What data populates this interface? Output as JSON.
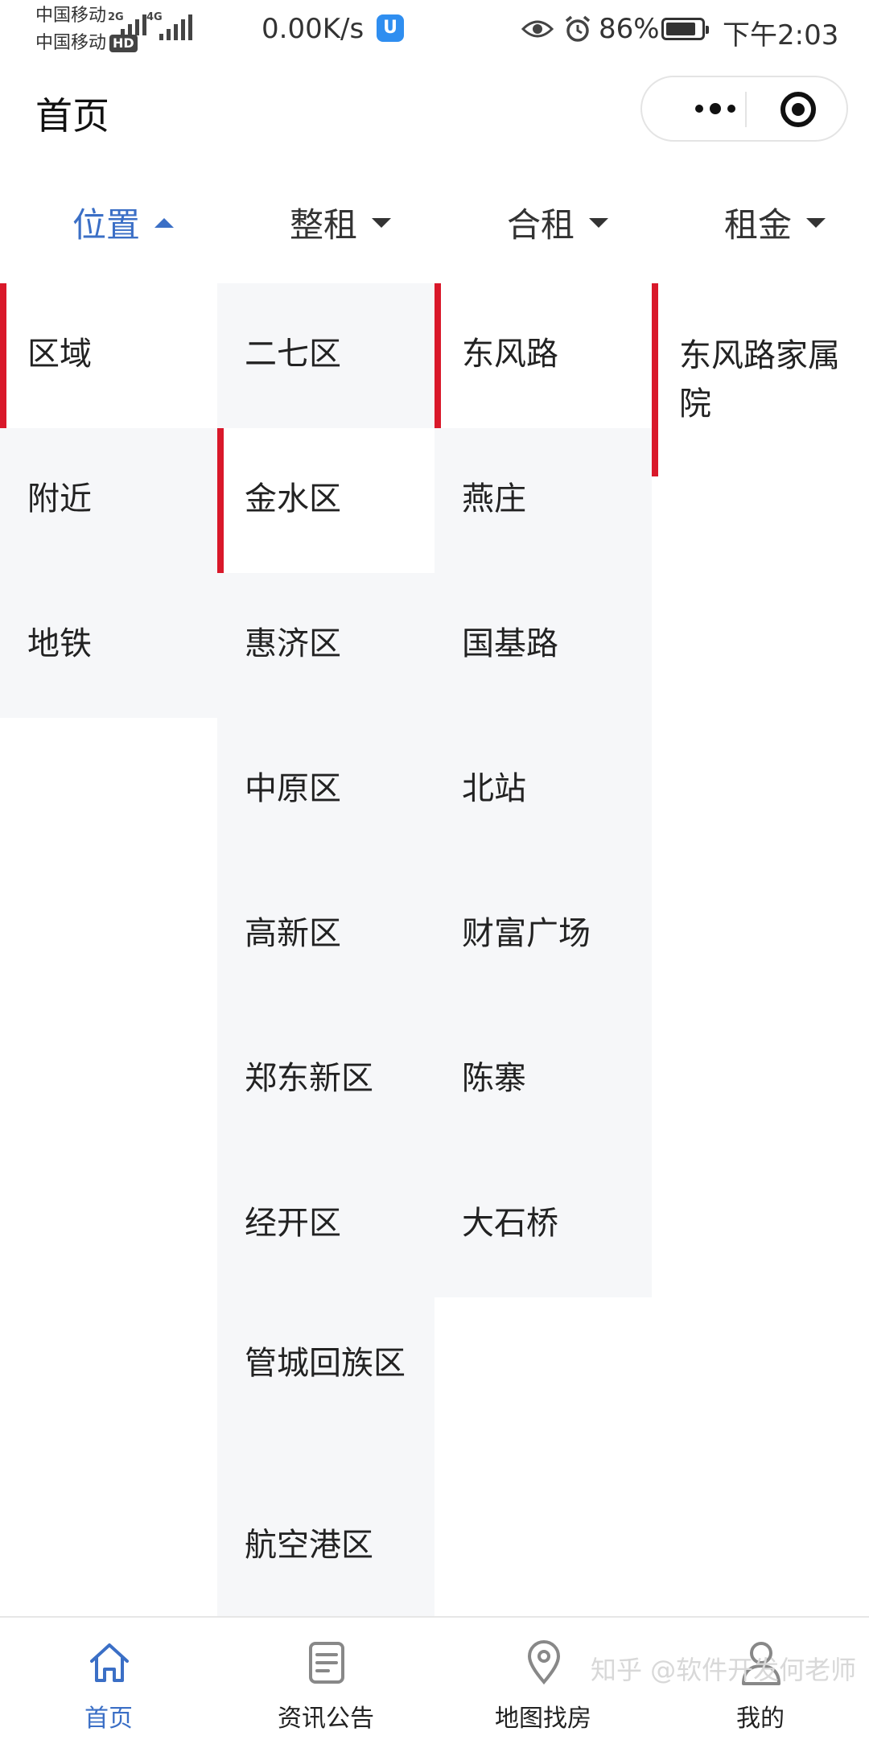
{
  "status_bar": {
    "carrier1": "中国移动",
    "carrier2": "中国移动",
    "hd": "HD",
    "net1": "2G",
    "net2": "4G",
    "speed": "0.00K/s",
    "app_badge": "U",
    "battery": "86%",
    "battery_level": 0.86,
    "time": "下午2:03"
  },
  "header": {
    "title": "首页"
  },
  "filters": [
    {
      "label": "位置",
      "active": true
    },
    {
      "label": "整租",
      "active": false
    },
    {
      "label": "合租",
      "active": false
    },
    {
      "label": "租金",
      "active": false
    }
  ],
  "columns": {
    "level1": [
      "区域",
      "附近",
      "地铁"
    ],
    "level2": [
      "二七区",
      "金水区",
      "惠济区",
      "中原区",
      "高新区",
      "郑东新区",
      "经开区",
      "管城回族区",
      "航空港区"
    ],
    "level3": [
      "东风路",
      "燕庄",
      "国基路",
      "北站",
      "财富广场",
      "陈寨",
      "大石桥"
    ],
    "level4": [
      "东风路家属院"
    ]
  },
  "tabbar": {
    "items": [
      {
        "label": "首页",
        "icon": "home-icon",
        "active": true
      },
      {
        "label": "资讯公告",
        "icon": "news-icon",
        "active": false
      },
      {
        "label": "地图找房",
        "icon": "map-pin-icon",
        "active": false
      },
      {
        "label": "我的",
        "icon": "user-icon",
        "active": false
      }
    ]
  },
  "watermark": "知乎 @软件开发何老师",
  "colors": {
    "accent": "#3b6fc6",
    "selected_bar": "#d9182a",
    "panel_bg": "#f6f7f9"
  }
}
